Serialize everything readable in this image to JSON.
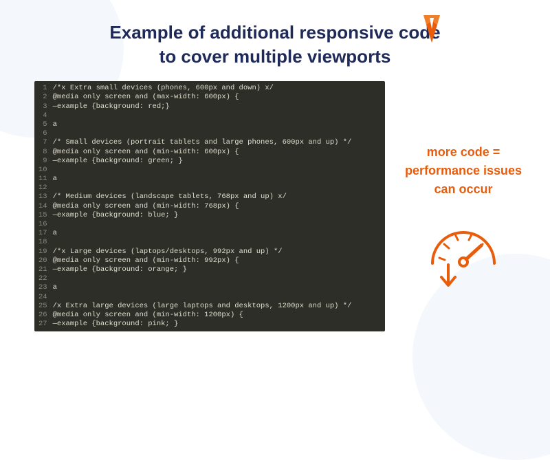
{
  "title_line1": "Example of additional responsive code",
  "title_line2": "to cover multiple viewports",
  "callout_line1": "more code =",
  "callout_line2": "performance issues",
  "callout_line3": "can occur",
  "code_lines": [
    "/*x Extra small devices (phones, 600px and down) x/",
    "@media only screen and (max-width: 600px) {",
    "—example {background: red;}",
    "",
    "a",
    "",
    "/* Small devices (portrait tablets and large phones, 600px and up) */",
    "@media only screen and (min-width: 600px) {",
    "—example {background: green; }",
    "",
    "a",
    "",
    "/* Medium devices (landscape tablets, 768px and up) x/",
    "@media only screen and (min-width: 768px) {",
    "—example {background: blue; }",
    "",
    "a",
    "",
    "/*x Large devices (laptops/desktops, 992px and up) */",
    "@media only screen and (min-width: 992px) {",
    "—example {background: orange; }",
    "",
    "a",
    "",
    "/x Extra large devices (large laptops and desktops, 1200px and up) */",
    "@media only screen and (min-width: 1200px) {",
    "—example {background: pink; }"
  ],
  "colors": {
    "title": "#1f2a59",
    "accent": "#e85c0c",
    "code_bg": "#2e2e28",
    "code_fg": "#dedecf",
    "gutter": "#8a8a82"
  },
  "icons": {
    "logo": "wp-rocket-logo",
    "gauge": "speed-gauge-down-icon"
  }
}
